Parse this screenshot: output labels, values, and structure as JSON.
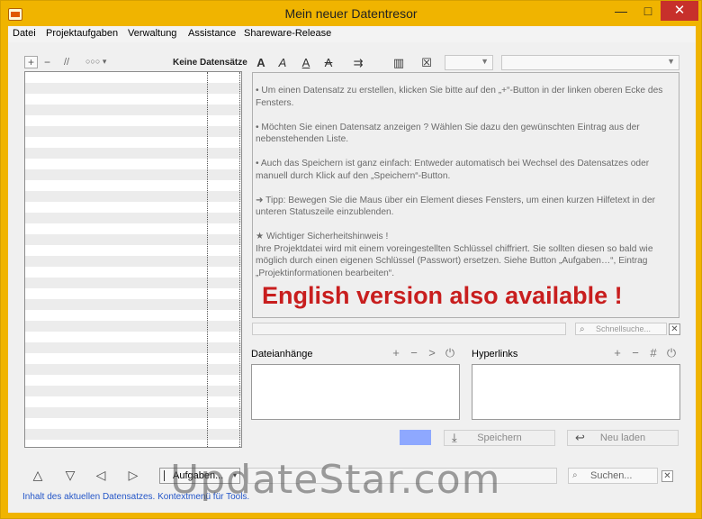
{
  "window": {
    "title": "Mein neuer Datentresor",
    "minimize": "—",
    "maximize": "□",
    "close": "✕"
  },
  "menu": [
    "Datei",
    "Projektaufgaben",
    "Verwaltung",
    "Assistance",
    "Shareware-Release"
  ],
  "left_toolbar": {
    "add": "+",
    "remove": "−",
    "pause": "//",
    "more": "○○○",
    "more_arrow": "▾",
    "status": "Keine Datensätze"
  },
  "format_toolbar": {
    "bold": "A",
    "italic": "A",
    "underline": "A",
    "strike": "A",
    "wrap": "⇉",
    "table": "▥",
    "clear": "☒"
  },
  "info": {
    "p1": "• Um einen Datensatz zu erstellen, klicken Sie bitte auf den „+“-Button in der linken oberen Ecke des Fensters.",
    "p2": "• Möchten Sie einen Datensatz anzeigen ? Wählen Sie dazu den gewünschten Eintrag aus der nebenstehenden Liste.",
    "p3": "• Auch das Speichern ist ganz einfach: Entweder automatisch bei Wechsel des Datensatzes oder manuell durch Klick auf den „Speichern“-Button.",
    "p4": "➜ Tipp: Bewegen Sie die Maus über ein Element dieses Fensters, um einen kurzen Hilfetext in der unteren Statuszeile einzublenden.",
    "p5_title": "★ Wichtiger Sicherheitshinweis !",
    "p5_body": "Ihre Projektdatei wird mit einem voreingestellten Schlüssel chiffriert. Sie sollten diesen so bald wie möglich durch einen eigenen Schlüssel (Passwort) ersetzen. Siehe Button „Aufgaben…“, Eintrag „Projektinformationen bearbeiten“.",
    "promo": "English version also available !"
  },
  "quick_search": {
    "placeholder": "Schnellsuche...",
    "clear": "✕"
  },
  "attachments": {
    "label": "Dateianhänge",
    "add": "+",
    "remove": "−",
    "open": ">",
    "power": "⏻"
  },
  "hyperlinks": {
    "label": "Hyperlinks",
    "add": "+",
    "remove": "−",
    "hash": "#",
    "power": "⏻"
  },
  "actions": {
    "save": "Speichern",
    "reload": "Neu laden",
    "swatch_color": "#8ea8ff"
  },
  "nav": {
    "up": "△",
    "down": "▽",
    "left": "◁",
    "right": "▷",
    "tasks": "Aufgaben...",
    "tasks_arrow": "▾",
    "search": "Suchen...",
    "clear": "✕"
  },
  "status": "Inhalt des aktuellen Datensatzes. Kontextmenü für Tools.",
  "watermark": "UpdateStar.com"
}
